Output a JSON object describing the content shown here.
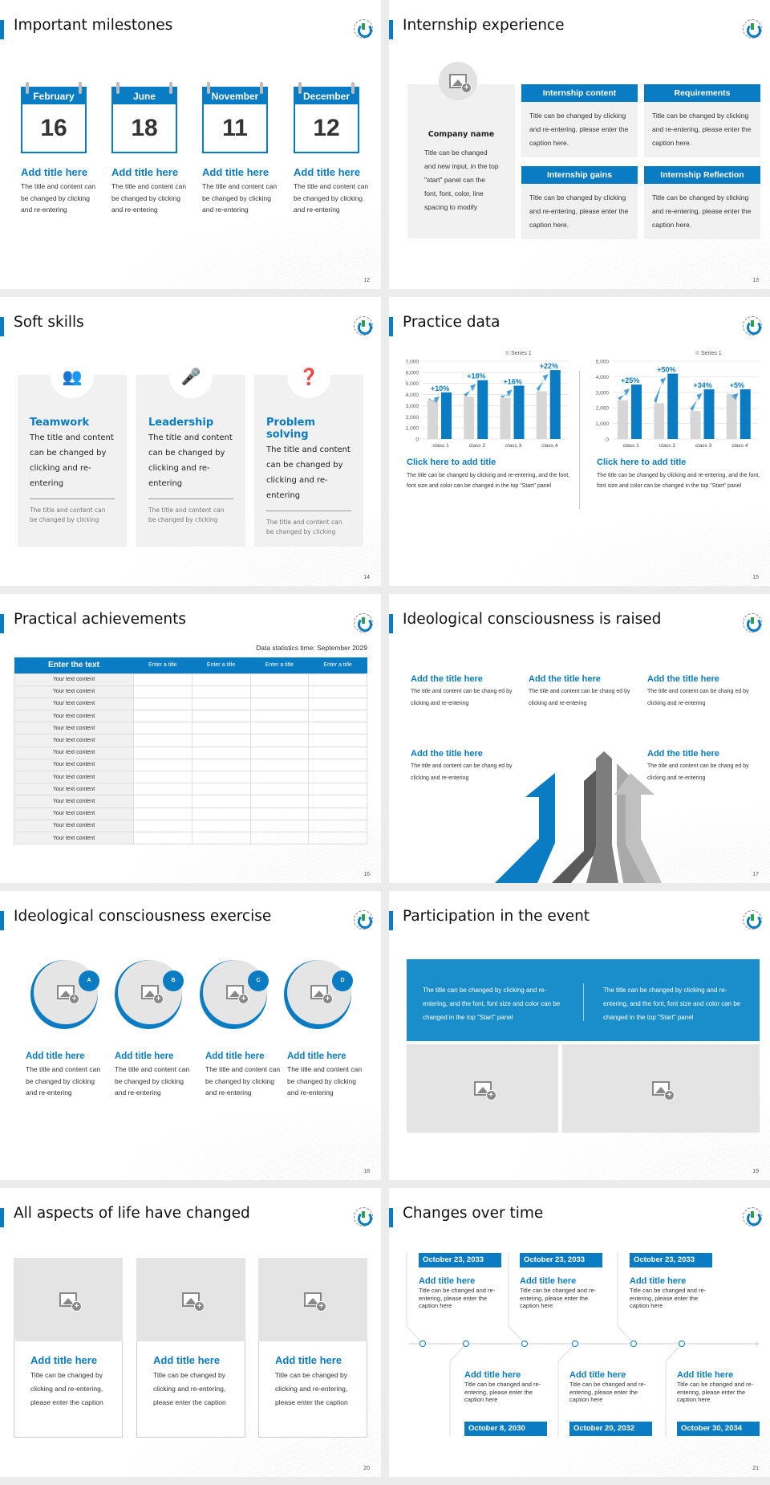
{
  "theme": {
    "accent": "#0a7cc4",
    "panel_gray": "#f1f1f1",
    "placeholder_gray": "#e4e4e4"
  },
  "slides": {
    "s12": {
      "title": "Important milestones",
      "page": "12",
      "items": [
        {
          "month": "February",
          "day": "16",
          "heading": "Add title here",
          "body": "The title and content can be changed by clicking and re-entering"
        },
        {
          "month": "June",
          "day": "18",
          "heading": "Add title here",
          "body": "The title and content can be changed by clicking and re-entering"
        },
        {
          "month": "November",
          "day": "11",
          "heading": "Add title here",
          "body": "The title and content can be changed by clicking and re-entering"
        },
        {
          "month": "December",
          "day": "12",
          "heading": "Add title here",
          "body": "The title and content can be changed by clicking and re-entering"
        }
      ]
    },
    "s13": {
      "title": "Internship experience",
      "page": "13",
      "company": {
        "name": "Company name",
        "body": "Title can be changed and new input, in the top \"start\" panel can the font, font, color, line spacing to modify"
      },
      "boxes": [
        {
          "heading": "Internship content",
          "body": "Title can be changed by clicking and re-entering, please enter the caption here."
        },
        {
          "heading": "Requirements",
          "body": "Title can be changed by clicking and re-entering, please enter the caption here."
        },
        {
          "heading": "Internship gains",
          "body": "Title can be changed by clicking and re-entering, please enter the caption here."
        },
        {
          "heading": "Internship Reflection",
          "body": "Title can be changed by clicking and re-entering, please enter the caption here."
        }
      ]
    },
    "s14": {
      "title": "Soft skills",
      "page": "14",
      "cards": [
        {
          "icon": "team-star-icon",
          "glyph": "👥",
          "heading": "Teamwork",
          "body": "The title and content can be changed by clicking and re-entering",
          "sub": "The title and content can be changed by clicking"
        },
        {
          "icon": "speaker-podium-icon",
          "glyph": "🎤",
          "heading": "Leadership",
          "body": "The title and content can be changed by clicking and re-entering",
          "sub": "The title and content can be changed by clicking"
        },
        {
          "icon": "person-question-icon",
          "glyph": "❓",
          "heading": "Problem solving",
          "body": "The title and content can be changed by clicking and re-entering",
          "sub": "The title and content can be changed by clicking"
        }
      ]
    },
    "s15": {
      "title": "Practice data",
      "page": "15",
      "captions": [
        {
          "heading": "Click here to add title",
          "body": "The title can be changed by clicking and re-entering, and the font, font size and color can be changed in the top \"Start\" panel"
        },
        {
          "heading": "Click here to add title",
          "body": "The title can be changed by clicking and re-entering, and the font, font size and color can be changed in the top \"Start\" panel"
        }
      ]
    },
    "s16": {
      "title": "Practical achievements",
      "page": "16",
      "stat_time": "Data statistics time: September 2029",
      "headers": [
        "Enter the text",
        "Enter a title",
        "Enter a title",
        "Enter a title",
        "Enter a title"
      ],
      "rows": [
        "Your text content",
        "Your text content",
        "Your text content",
        "Your text content",
        "Your text content",
        "Your text content",
        "Your text content",
        "Your text content",
        "Your text content",
        "Your text content",
        "Your text content",
        "Your text content",
        "Your text content",
        "Your text content"
      ]
    },
    "s17": {
      "title": "Ideological consciousness is raised",
      "page": "17",
      "items": [
        {
          "heading": "Add the title here",
          "body": "The title and content can be chang ed by clicking and re-entering"
        },
        {
          "heading": "Add the title here",
          "body": "The title and content can be chang ed by clicking and re-entering"
        },
        {
          "heading": "Add the title here",
          "body": "The title and content can be chang ed by clicking and re-entering"
        },
        {
          "heading": "Add the title here",
          "body": "The title and content can be chang ed by clicking and re-entering"
        },
        {
          "heading": "Add the title here",
          "body": "The title and content can be chang ed by clicking and re-entering"
        }
      ]
    },
    "s18": {
      "title": "Ideological consciousness exercise",
      "page": "18",
      "items": [
        {
          "badge": "A",
          "heading": "Add title here",
          "body": "The title and content can be changed by clicking and re-entering"
        },
        {
          "badge": "B",
          "heading": "Add title here",
          "body": "The title and content can be changed by clicking and re-entering"
        },
        {
          "badge": "C",
          "heading": "Add title here",
          "body": "The title and content can be changed by clicking and re-entering"
        },
        {
          "badge": "D",
          "heading": "Add title here",
          "body": "The title and content can be changed by clicking and re-entering"
        }
      ]
    },
    "s19": {
      "title": "Participation in the event",
      "page": "19",
      "band": [
        "The title can be changed by clicking and re-entering, and the font, font size and color can be changed in the top \"Start\" panel",
        "The title can be changed by clicking and re-entering, and the font, font size and color can be changed in the top \"Start\" panel"
      ]
    },
    "s20": {
      "title": "All aspects of life have changed",
      "page": "20",
      "cards": [
        {
          "heading": "Add title here",
          "body": "Title can be changed by clicking and re-entering, please enter the caption"
        },
        {
          "heading": "Add title here",
          "body": "Title can be changed by clicking and re-entering, please enter the caption"
        },
        {
          "heading": "Add title here",
          "body": "Title can be changed by clicking and re-entering, please enter the caption"
        }
      ]
    },
    "s21": {
      "title": "Changes over time",
      "page": "21",
      "top": [
        {
          "date": "October 23, 2033",
          "heading": "Add title here",
          "body": "Title can be changed and re-entering, please enter the caption here"
        },
        {
          "date": "October 23, 2033",
          "heading": "Add title here",
          "body": "Title can be changed and re-entering, please enter the caption here"
        },
        {
          "date": "October 23, 2033",
          "heading": "Add title here",
          "body": "Title can be changed and re-entering, please enter the caption here"
        }
      ],
      "bottom": [
        {
          "date": "October 8, 2030",
          "heading": "Add title here",
          "body": "Title can be changed and re-entering, please enter the caption here"
        },
        {
          "date": "October 20, 2032",
          "heading": "Add title here",
          "body": "Title can be changed and re-entering, please enter the caption here"
        },
        {
          "date": "October 30, 2034",
          "heading": "Add title here",
          "body": "Title can be changed and re-entering, please enter the caption here"
        }
      ]
    }
  },
  "chart_data": [
    {
      "type": "bar",
      "title": "",
      "categories": [
        "class 1",
        "class 2",
        "class 3",
        "class 4"
      ],
      "series": [
        {
          "name": "Series 1",
          "values": [
            3500,
            3800,
            3700,
            4300
          ],
          "color": "#d6d6d6"
        },
        {
          "name": "",
          "values": [
            4200,
            5300,
            4800,
            6200
          ],
          "color": "#0a7cc4"
        }
      ],
      "annotations": [
        "+10%",
        "+18%",
        "+16%",
        "+22%"
      ],
      "legend": [
        "Series 1"
      ],
      "legend_position": "top-right",
      "ylim": [
        0,
        7000
      ],
      "yticks": [
        0,
        1000,
        2000,
        3000,
        4000,
        5000,
        6000,
        7000
      ],
      "ytick_labels": [
        "0",
        "1,000",
        "2,000",
        "3,000",
        "4,000",
        "5,000",
        "6,000",
        "7,000"
      ],
      "grid": true,
      "xlabel": "",
      "ylabel": ""
    },
    {
      "type": "bar",
      "title": "",
      "categories": [
        "class 1",
        "class 2",
        "class 3",
        "class 4"
      ],
      "series": [
        {
          "name": "Series 1",
          "values": [
            2500,
            2300,
            1800,
            2900
          ],
          "color": "#d6d6d6"
        },
        {
          "name": "",
          "values": [
            3500,
            4200,
            3200,
            3200
          ],
          "color": "#0a7cc4"
        }
      ],
      "annotations": [
        "+25%",
        "+50%",
        "+34%",
        "+5%"
      ],
      "legend": [
        "Series 1"
      ],
      "legend_position": "top-right",
      "ylim": [
        0,
        5000
      ],
      "yticks": [
        0,
        1000,
        2000,
        3000,
        4000,
        5000
      ],
      "ytick_labels": [
        "0",
        "1,000",
        "2,000",
        "3,000",
        "4,000",
        "5,000"
      ],
      "grid": true,
      "xlabel": "",
      "ylabel": ""
    }
  ]
}
